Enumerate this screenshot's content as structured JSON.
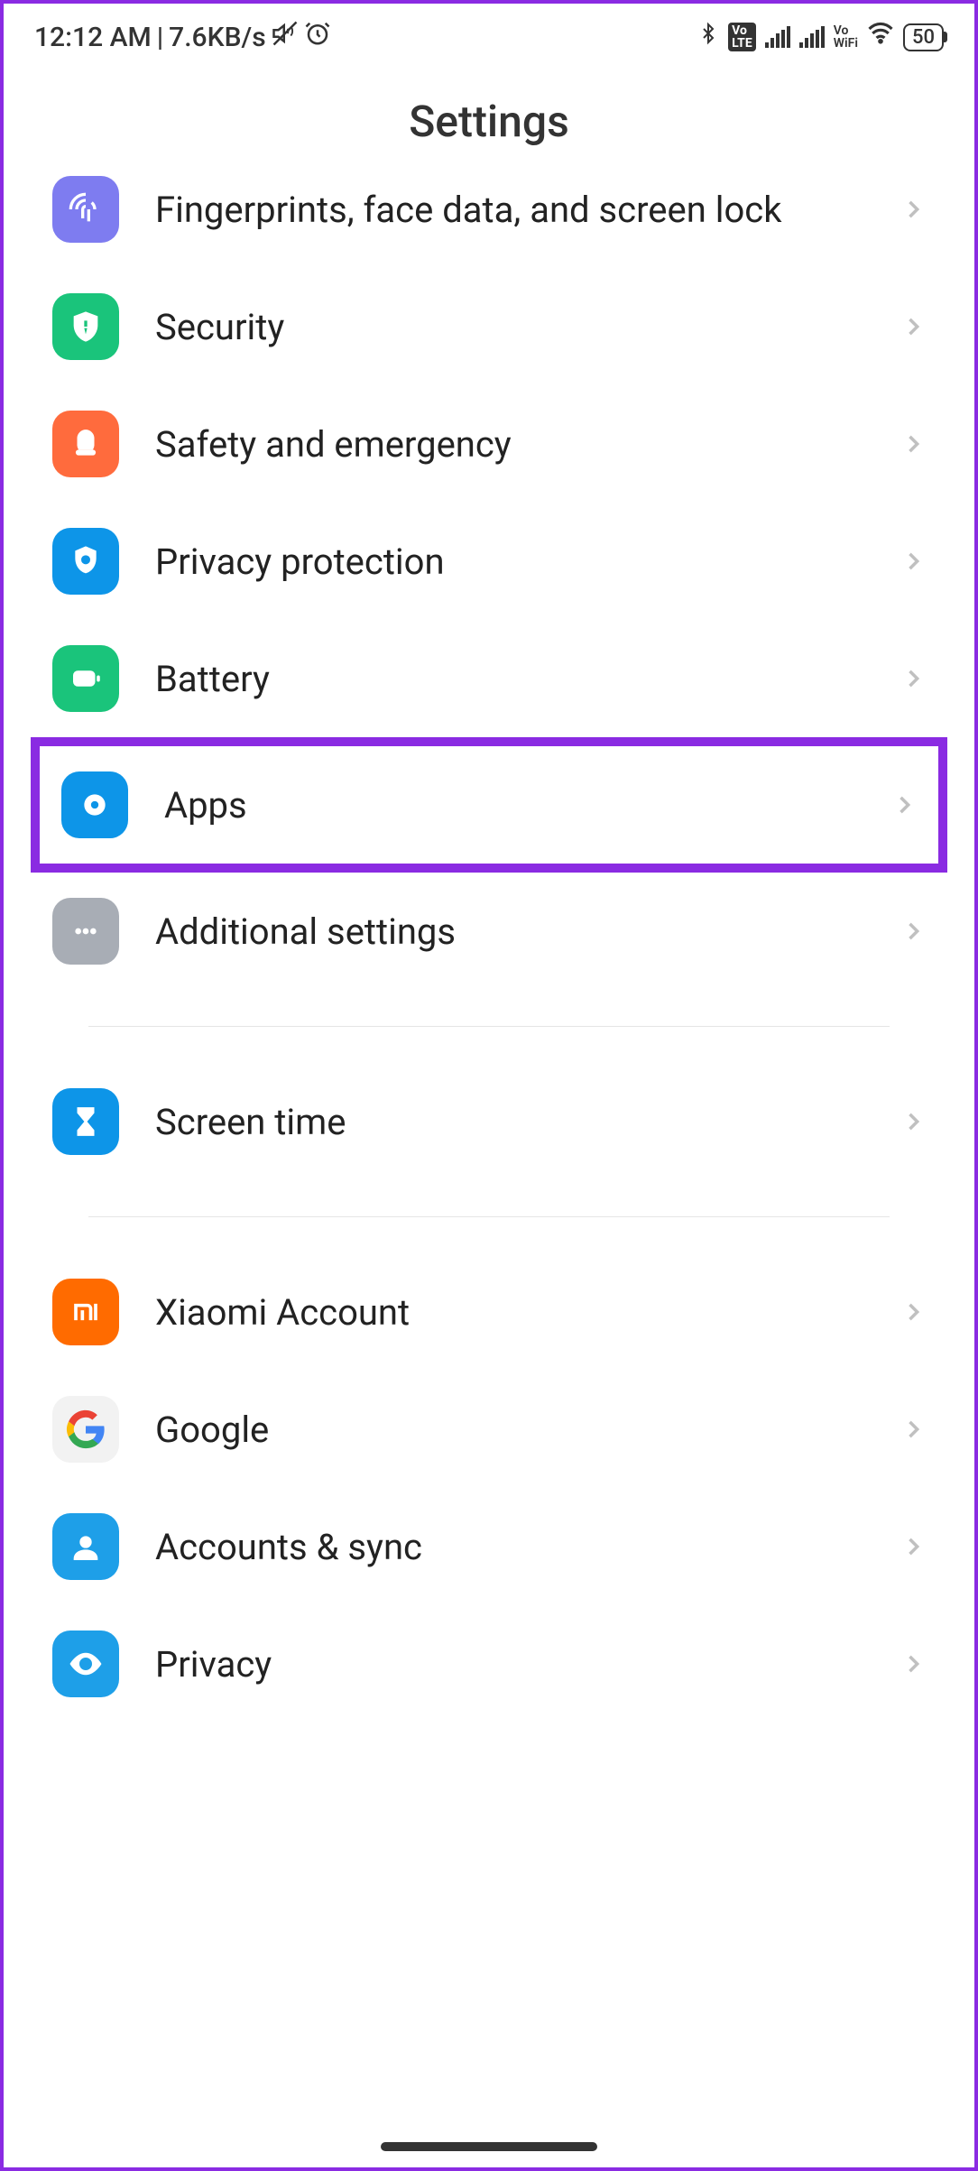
{
  "status": {
    "time": "12:12 AM",
    "net_speed": "7.6KB/s",
    "battery": "50",
    "volte": "Vo\nLTE",
    "vowifi_top": "Vo",
    "vowifi_bot": "WiFi"
  },
  "header": {
    "title": "Settings"
  },
  "rows": {
    "fingerprints": "Fingerprints, face data, and screen lock",
    "security": "Security",
    "safety": "Safety and emergency",
    "privacy_protection": "Privacy protection",
    "battery": "Battery",
    "apps": "Apps",
    "additional": "Additional settings",
    "screen_time": "Screen time",
    "xiaomi": "Xiaomi Account",
    "google": "Google",
    "accounts": "Accounts & sync",
    "privacy": "Privacy"
  }
}
